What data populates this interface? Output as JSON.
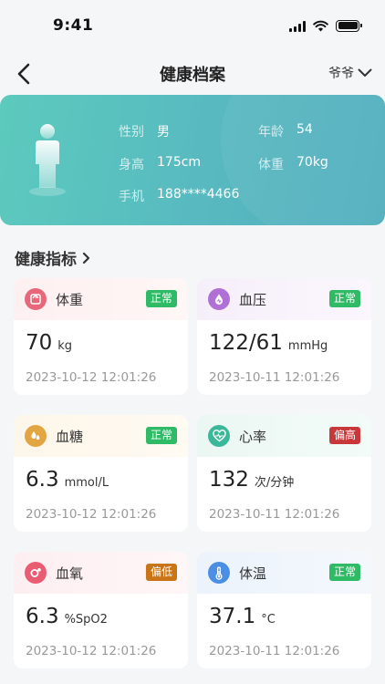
{
  "status_bar": {
    "time": "9:41"
  },
  "nav": {
    "title": "健康档案",
    "member": "爷爷"
  },
  "profile": {
    "gender_label": "性别",
    "gender": "男",
    "age_label": "年龄",
    "age": "54",
    "height_label": "身高",
    "height": "175cm",
    "weight_label": "体重",
    "weight": "70kg",
    "phone_label": "手机",
    "phone": "188****4466"
  },
  "section": {
    "title": "健康指标"
  },
  "metrics": [
    {
      "name": "体重",
      "status": "正常",
      "value": "70",
      "unit": "kg",
      "time": "2023-10-12 12:01:26",
      "icon": "weight-icon"
    },
    {
      "name": "血压",
      "status": "正常",
      "value": "122/61",
      "unit": "mmHg",
      "time": "2023-10-11 12:01:26",
      "icon": "blood-pressure-icon"
    },
    {
      "name": "血糖",
      "status": "正常",
      "value": "6.3",
      "unit": "mmol/L",
      "time": "2023-10-12 12:01:26",
      "icon": "blood-sugar-icon"
    },
    {
      "name": "心率",
      "status": "偏高",
      "value": "132",
      "unit": "次/分钟",
      "time": "2023-10-11 12:01:26",
      "icon": "heart-rate-icon"
    },
    {
      "name": "血氧",
      "status": "偏低",
      "value": "6.3",
      "unit": "%SpO2",
      "time": "2023-10-12 12:01:26",
      "icon": "blood-oxygen-icon"
    },
    {
      "name": "体温",
      "status": "正常",
      "value": "37.1",
      "unit": "°C",
      "time": "2023-10-11 12:01:26",
      "icon": "thermometer-icon"
    }
  ],
  "colors": {
    "normal_badge": "#2fbb66",
    "high_badge": "#c8383b",
    "low_badge": "#c87417",
    "card_gradient_start": "#5ccabd",
    "card_gradient_end": "#52aebe"
  }
}
